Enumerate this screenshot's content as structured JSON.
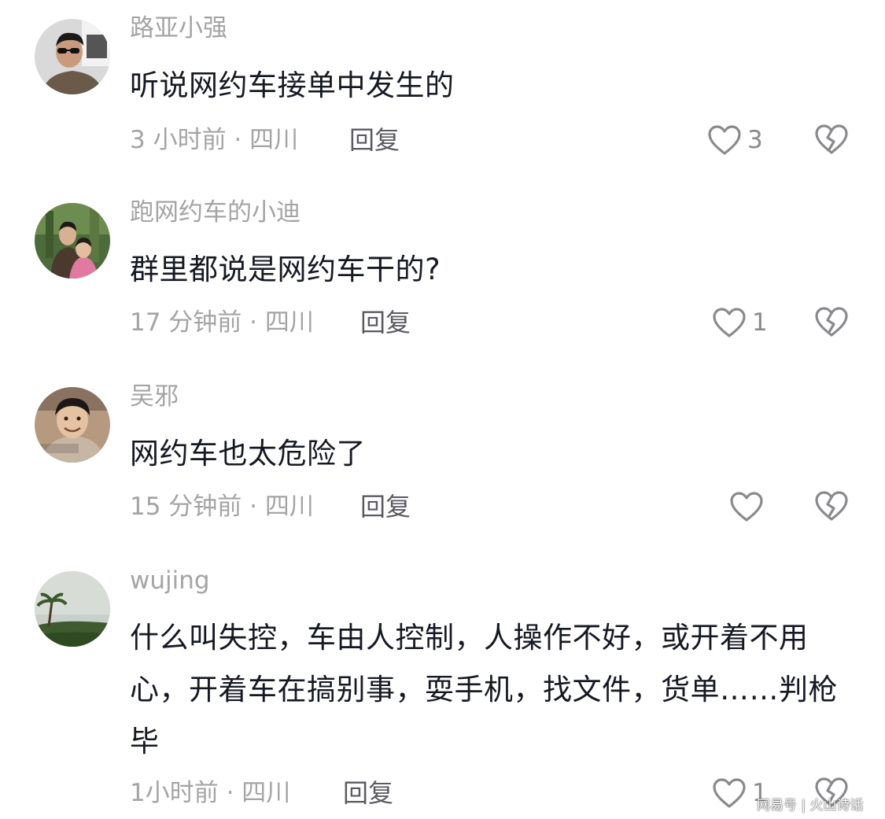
{
  "comments": [
    {
      "username": "路亚小强",
      "text": "听说网约车接单中发生的",
      "meta": "3 小时前 · 四川",
      "reply": "回复",
      "likes": "3",
      "avatar_icon": "man-sunglasses-avatar"
    },
    {
      "username": "跑网约车的小迪",
      "text": "群里都说是网约车干的?",
      "meta": "17 分钟前 · 四川",
      "reply": "回复",
      "likes": "1",
      "avatar_icon": "couple-photo-avatar"
    },
    {
      "username": "吴邪",
      "text": "网约车也太危险了",
      "meta": "15 分钟前 · 四川",
      "reply": "回复",
      "likes": "",
      "avatar_icon": "man-smiling-avatar"
    },
    {
      "username": "wujing",
      "text": "什么叫失控，车由人控制，人操作不好，或开着不用心，开着车在搞别事，耍手机，找文件，货单……判枪毕",
      "meta": "1小时前 · 四川",
      "reply": "回复",
      "likes": "1",
      "avatar_icon": "landscape-avatar"
    }
  ],
  "icons": {
    "like": "heart-outline-icon",
    "dislike": "broken-heart-icon"
  },
  "watermark": "网易号 | 火山诗话",
  "colors": {
    "username": "#a4a4a6",
    "text": "#161823",
    "meta": "#a4a4a6",
    "reply": "#5a5a60",
    "icon": "#8a8a8e"
  }
}
